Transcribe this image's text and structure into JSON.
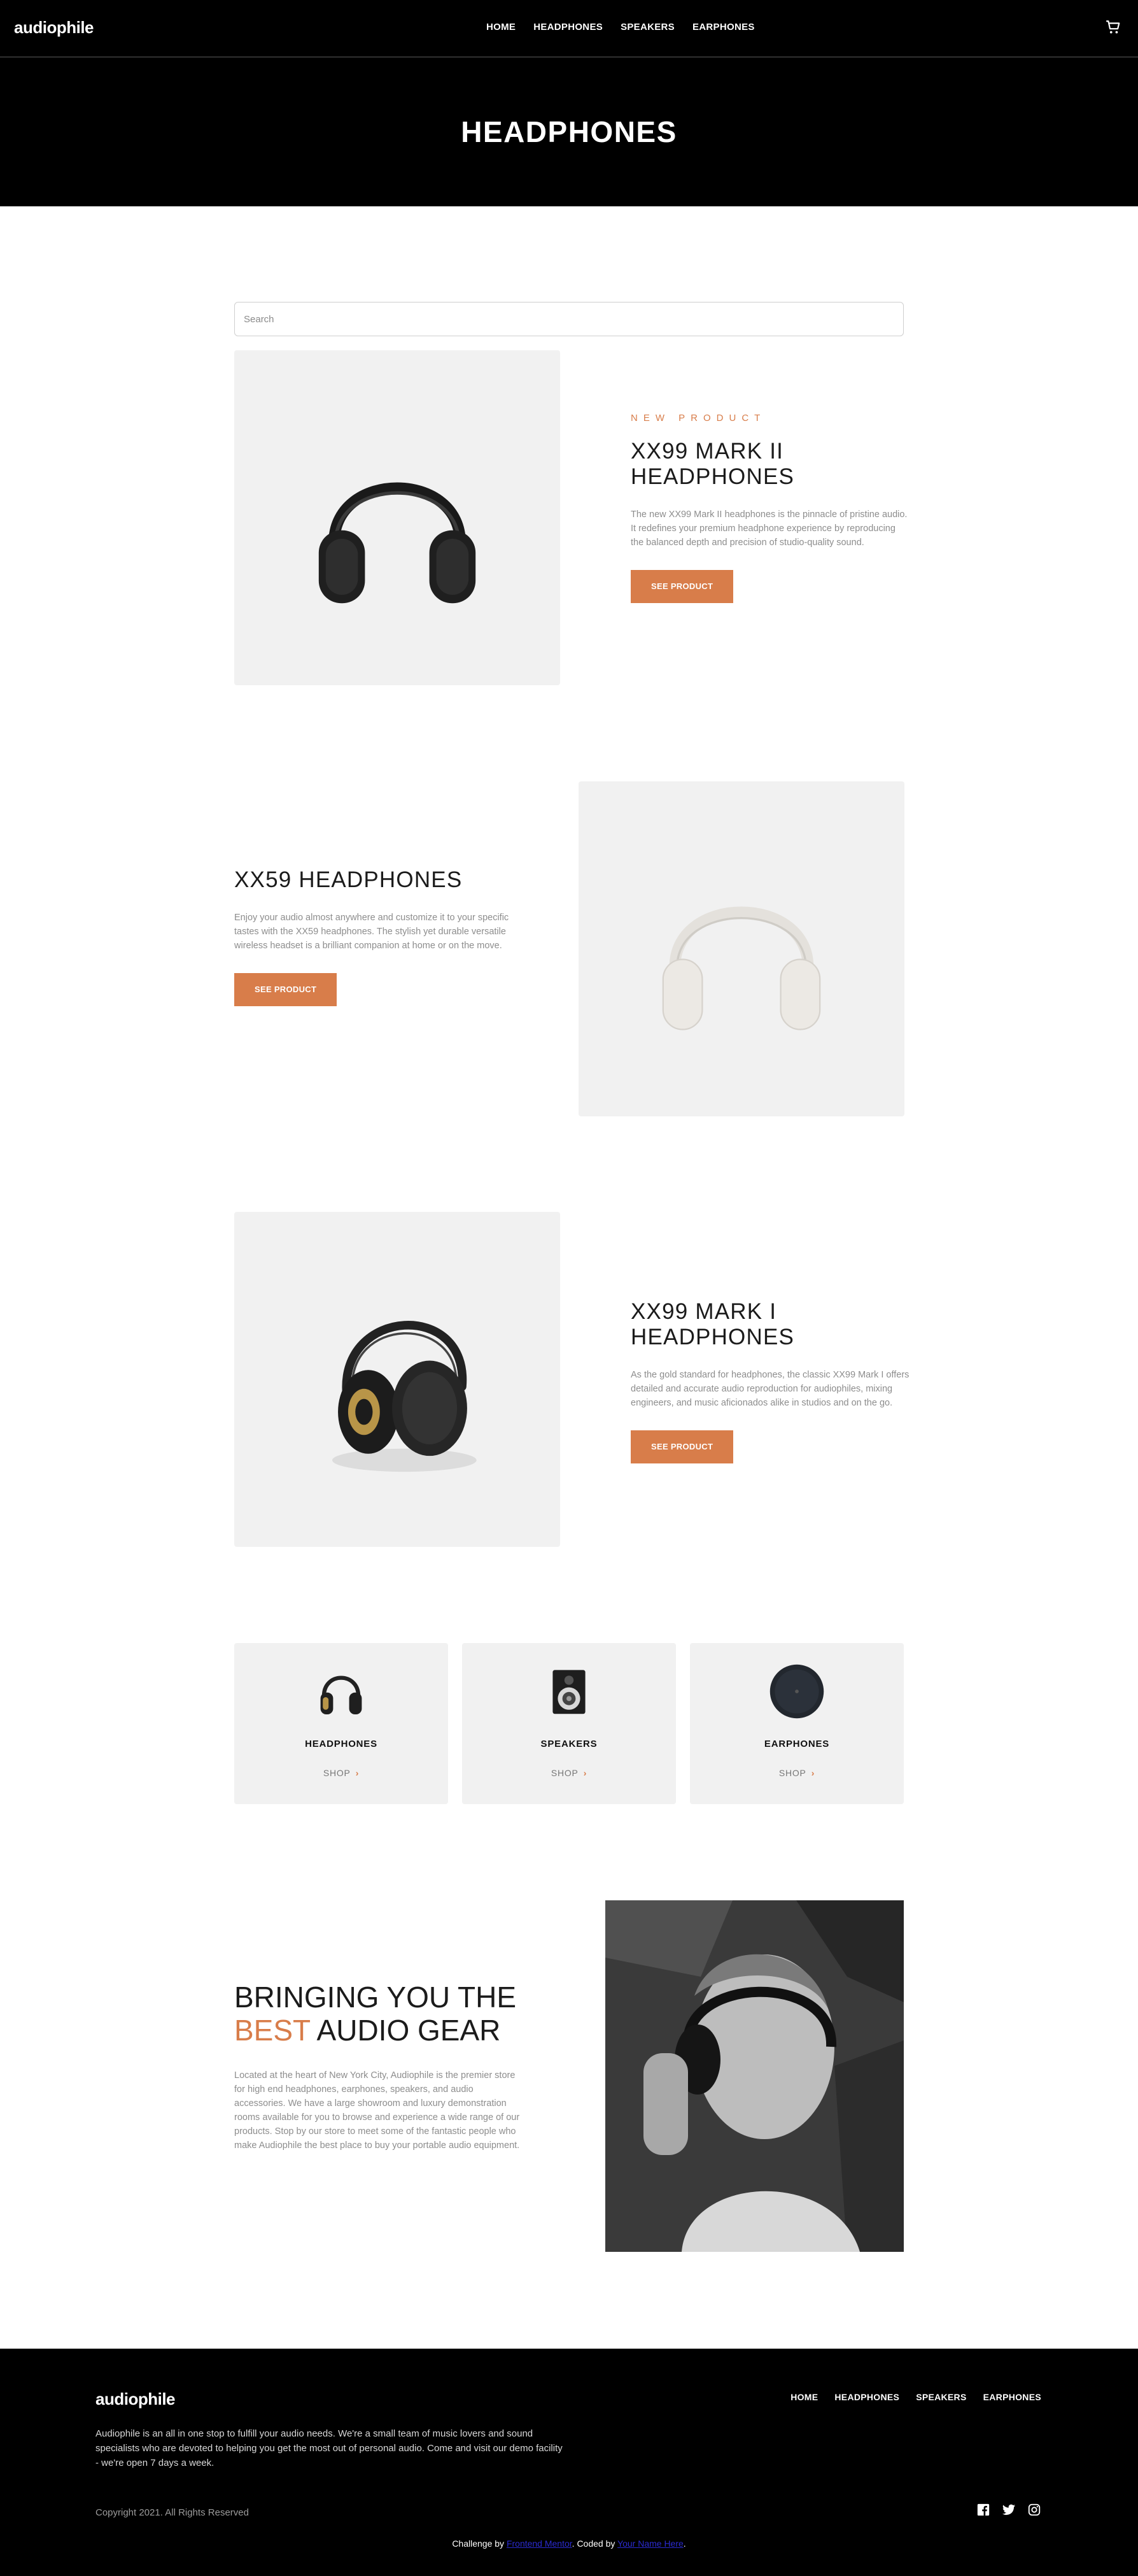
{
  "header": {
    "logo": "audiophile",
    "nav": [
      "HOME",
      "HEADPHONES",
      "SPEAKERS",
      "EARPHONES"
    ],
    "cart_icon": "cart-icon",
    "page_title": "HEADPHONES"
  },
  "search": {
    "placeholder": "Search",
    "value": ""
  },
  "products": [
    {
      "overline": "NEW PRODUCT",
      "name": "XX99 MARK II HEADPHONES",
      "description": "The new XX99 Mark II headphones is the pinnacle of pristine audio. It redefines your premium headphone experience by reproducing the balanced depth and precision of studio-quality sound.",
      "button": "SEE PRODUCT"
    },
    {
      "overline": "",
      "name": "XX59 HEADPHONES",
      "description": "Enjoy your audio almost anywhere and customize it to your specific tastes with the XX59 headphones. The stylish yet durable versatile wireless headset is a brilliant companion at home or on the move.",
      "button": "SEE PRODUCT"
    },
    {
      "overline": "",
      "name": "XX99 MARK I HEADPHONES",
      "description": "As the gold standard for headphones, the classic XX99 Mark I offers detailed and accurate audio reproduction for audiophiles, mixing engineers, and music aficionados alike in studios and on the go.",
      "button": "SEE PRODUCT"
    }
  ],
  "categories": [
    {
      "title": "HEADPHONES",
      "shop": "SHOP"
    },
    {
      "title": "SPEAKERS",
      "shop": "SHOP"
    },
    {
      "title": "EARPHONES",
      "shop": "SHOP"
    }
  ],
  "about": {
    "title_line1": "BRINGING YOU THE",
    "title_accent": "BEST",
    "title_rest": " AUDIO GEAR",
    "text": "Located at the heart of New York City, Audiophile is the premier store for high end headphones, earphones, speakers, and audio accessories. We have a large showroom and luxury demonstration rooms available for you to browse and experience a wide range of our products. Stop by our store to meet some of the fantastic people who make Audiophile the best place to buy your portable audio equipment."
  },
  "footer": {
    "logo": "audiophile",
    "nav": [
      "HOME",
      "HEADPHONES",
      "SPEAKERS",
      "EARPHONES"
    ],
    "description": "Audiophile is an all in one stop to fulfill your audio needs. We're a small team of music lovers and sound specialists who are devoted to helping you get the most out of personal audio. Come and visit our demo facility - we're open 7 days a week.",
    "copyright": "Copyright 2021. All Rights Reserved",
    "socials": [
      "facebook-icon",
      "twitter-icon",
      "instagram-icon"
    ],
    "credit_prefix": "Challenge by ",
    "credit_link1": "Frontend Mentor",
    "credit_middle": ". Coded by ",
    "credit_link2": "Your Name Here",
    "credit_suffix": "."
  },
  "colors": {
    "accent": "#d87d4a",
    "dark": "#000000",
    "panel": "#f1f1f1"
  }
}
